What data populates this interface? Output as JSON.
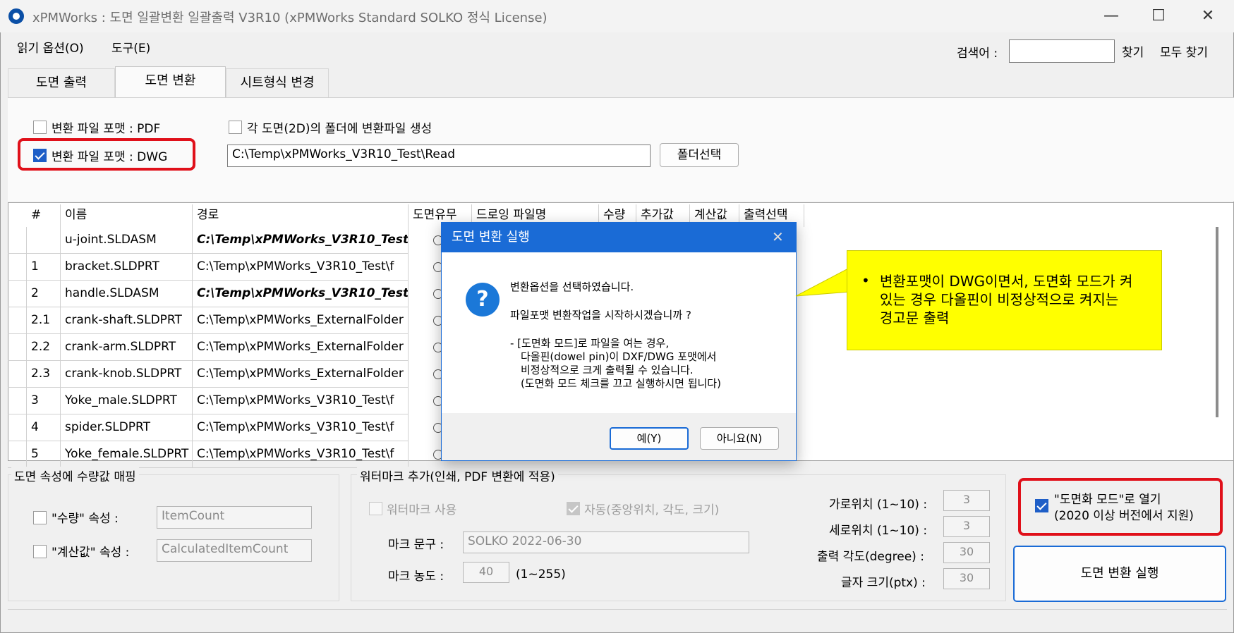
{
  "window": {
    "title": "xPMWorks : 도면 일괄변환 일괄출력 V3R10 (xPMWorks Standard SOLKO 정식 License)",
    "minimize": "—",
    "maximize": "☐",
    "close": "✕"
  },
  "menu": {
    "items": [
      "읽기 옵션(O)",
      "도구(E)"
    ]
  },
  "search": {
    "label": "검색어 :",
    "value": "",
    "find": "찾기",
    "find_all": "모두 찾기"
  },
  "tabs": [
    {
      "label": "도면 출력",
      "active": false
    },
    {
      "label": "도면 변환",
      "active": true
    },
    {
      "label": "시트형식 변경",
      "active": false
    }
  ],
  "convert": {
    "pdf_label": "변환 파일 포맷 : PDF",
    "pdf_checked": false,
    "dwg_label": "변환 파일 포맷 : DWG",
    "dwg_checked": true,
    "each_folder_label": "각 도면(2D)의 폴더에 변환파일 생성",
    "each_folder_checked": false,
    "folder_path": "C:\\Temp\\xPMWorks_V3R10_Test\\Read",
    "folder_button": "폴더선택"
  },
  "grid": {
    "columns": [
      "#",
      "이름",
      "경로",
      "도면유무",
      "드로잉 파일명",
      "수량",
      "추가값",
      "계산값",
      "출력선택"
    ],
    "rows": [
      {
        "num": "",
        "name": "u-joint.SLDASM",
        "path": "C:\\Temp\\xPMWorks_V3R10_Test",
        "bold": true
      },
      {
        "num": "1",
        "name": "bracket.SLDPRT",
        "path": "C:\\Temp\\xPMWorks_V3R10_Test\\f",
        "bold": false
      },
      {
        "num": "2",
        "name": "handle.SLDASM",
        "path": "C:\\Temp\\xPMWorks_V3R10_Test",
        "bold": true
      },
      {
        "num": "2.1",
        "name": "crank-shaft.SLDPRT",
        "path": "C:\\Temp\\xPMWorks_ExternalFolder",
        "bold": false
      },
      {
        "num": "2.2",
        "name": "crank-arm.SLDPRT",
        "path": "C:\\Temp\\xPMWorks_ExternalFolder",
        "bold": false
      },
      {
        "num": "2.3",
        "name": "crank-knob.SLDPRT",
        "path": "C:\\Temp\\xPMWorks_ExternalFolder",
        "bold": false
      },
      {
        "num": "3",
        "name": "Yoke_male.SLDPRT",
        "path": "C:\\Temp\\xPMWorks_V3R10_Test\\f",
        "bold": false
      },
      {
        "num": "4",
        "name": "spider.SLDPRT",
        "path": "C:\\Temp\\xPMWorks_V3R10_Test\\f",
        "bold": false
      },
      {
        "num": "5",
        "name": "Yoke_female.SLDPRT",
        "path": "C:\\Temp\\xPMWorks_V3R10_Test\\f",
        "bold": false
      }
    ]
  },
  "mapping": {
    "title": "도면 속성에 수량값 매핑",
    "qty_label": "\"수량\" 속성 :",
    "qty_value": "ItemCount",
    "calc_label": "\"계산값\" 속성 :",
    "calc_value": "CalculatedItemCount"
  },
  "watermark": {
    "title": "워터마크 추가(인쇄, PDF 변환에 적용)",
    "use_label": "워터마크 사용",
    "auto_label": "자동(중앙위치, 각도, 크기)",
    "mark_text_label": "마크 문구 :",
    "mark_text_value": "SOLKO 2022-06-30",
    "density_label": "마크 농도 :",
    "density_value": "40",
    "density_range": "(1~255)",
    "h_pos_label": "가로위치 (1~10) :",
    "h_pos_value": "3",
    "v_pos_label": "세로위치 (1~10) :",
    "v_pos_value": "3",
    "angle_label": "출력 각도(degree) :",
    "angle_value": "30",
    "size_label": "글자 크기(ptx) :",
    "size_value": "30"
  },
  "drawing_mode": {
    "line1": "\"도면화 모드\"로 열기",
    "line2": "(2020 이상 버전에서 지원)",
    "checked": true
  },
  "run_button": "도면 변환 실행",
  "dialog": {
    "title": "도면 변환 실행",
    "close": "✕",
    "icon": "?",
    "line1": "변환옵션을 선택하였습니다.",
    "line2": "파일포맷 변환작업을 시작하시겠습니까 ?",
    "line3": "- [도면화 모드]로 파일을 여는 경우,",
    "line4": "다올핀(dowel pin)이 DXF/DWG 포맷에서",
    "line5": "비정상적으로 크게 출력될 수 있습니다.",
    "line6": "(도면화 모드 체크를 끄고 실행하시면 됩니다)",
    "yes": "예(Y)",
    "no": "아니요(N)"
  },
  "callout": {
    "bullet": "•",
    "text": "변환포맷이 DWG이면서, 도면화 모드가 켜 있는 경우 다올핀이 비정상적으로 켜지는 경고문 출력"
  },
  "colors": {
    "accent": "#1a6bd6",
    "highlight": "#e0101a",
    "callout": "#ffff00"
  }
}
